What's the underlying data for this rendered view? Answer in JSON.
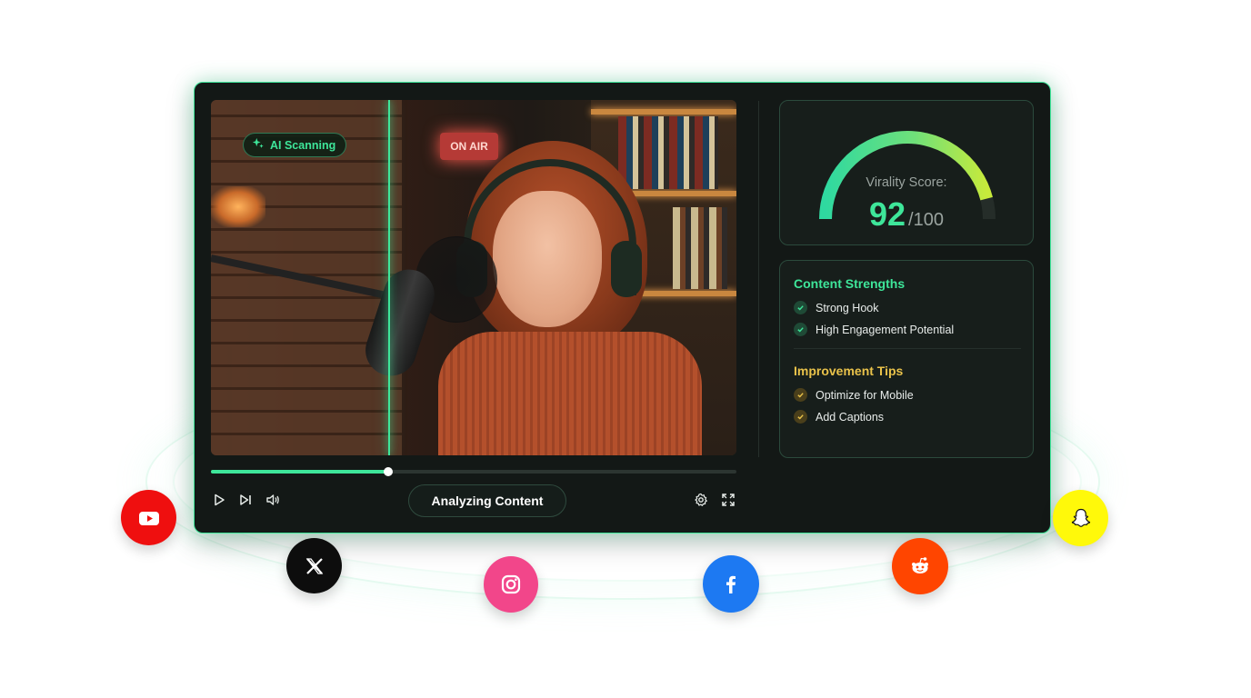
{
  "badge": {
    "label": "AI Scanning",
    "icon": "sparkle-icon"
  },
  "video": {
    "sign_text": "ON AIR",
    "progress_fraction": 0.338
  },
  "controls": {
    "play": "play-icon",
    "next": "skip-next-icon",
    "volume": "volume-icon",
    "status_button": "Analyzing Content",
    "settings": "gear-icon",
    "fullscreen": "fullscreen-icon"
  },
  "score": {
    "label": "Virality Score:",
    "value": "92",
    "max": "/100",
    "fraction": 0.92
  },
  "strengths": {
    "title": "Content Strengths",
    "items": [
      "Strong Hook",
      "High Engagement Potential"
    ]
  },
  "tips": {
    "title": "Improvement Tips",
    "items": [
      "Optimize for Mobile",
      "Add Captions"
    ]
  },
  "colors": {
    "accent": "#3ee69a",
    "gold": "#e9c24a",
    "panel": "#131816",
    "youtube": "#ef0f0f",
    "x": "#0d0d0d",
    "instagram": "#f2468a",
    "facebook": "#1d79f2",
    "reddit": "#ff4500",
    "snapchat": "#fff90a"
  },
  "social": [
    "youtube-icon",
    "x-icon",
    "instagram-icon",
    "facebook-icon",
    "reddit-icon",
    "snapchat-icon"
  ]
}
